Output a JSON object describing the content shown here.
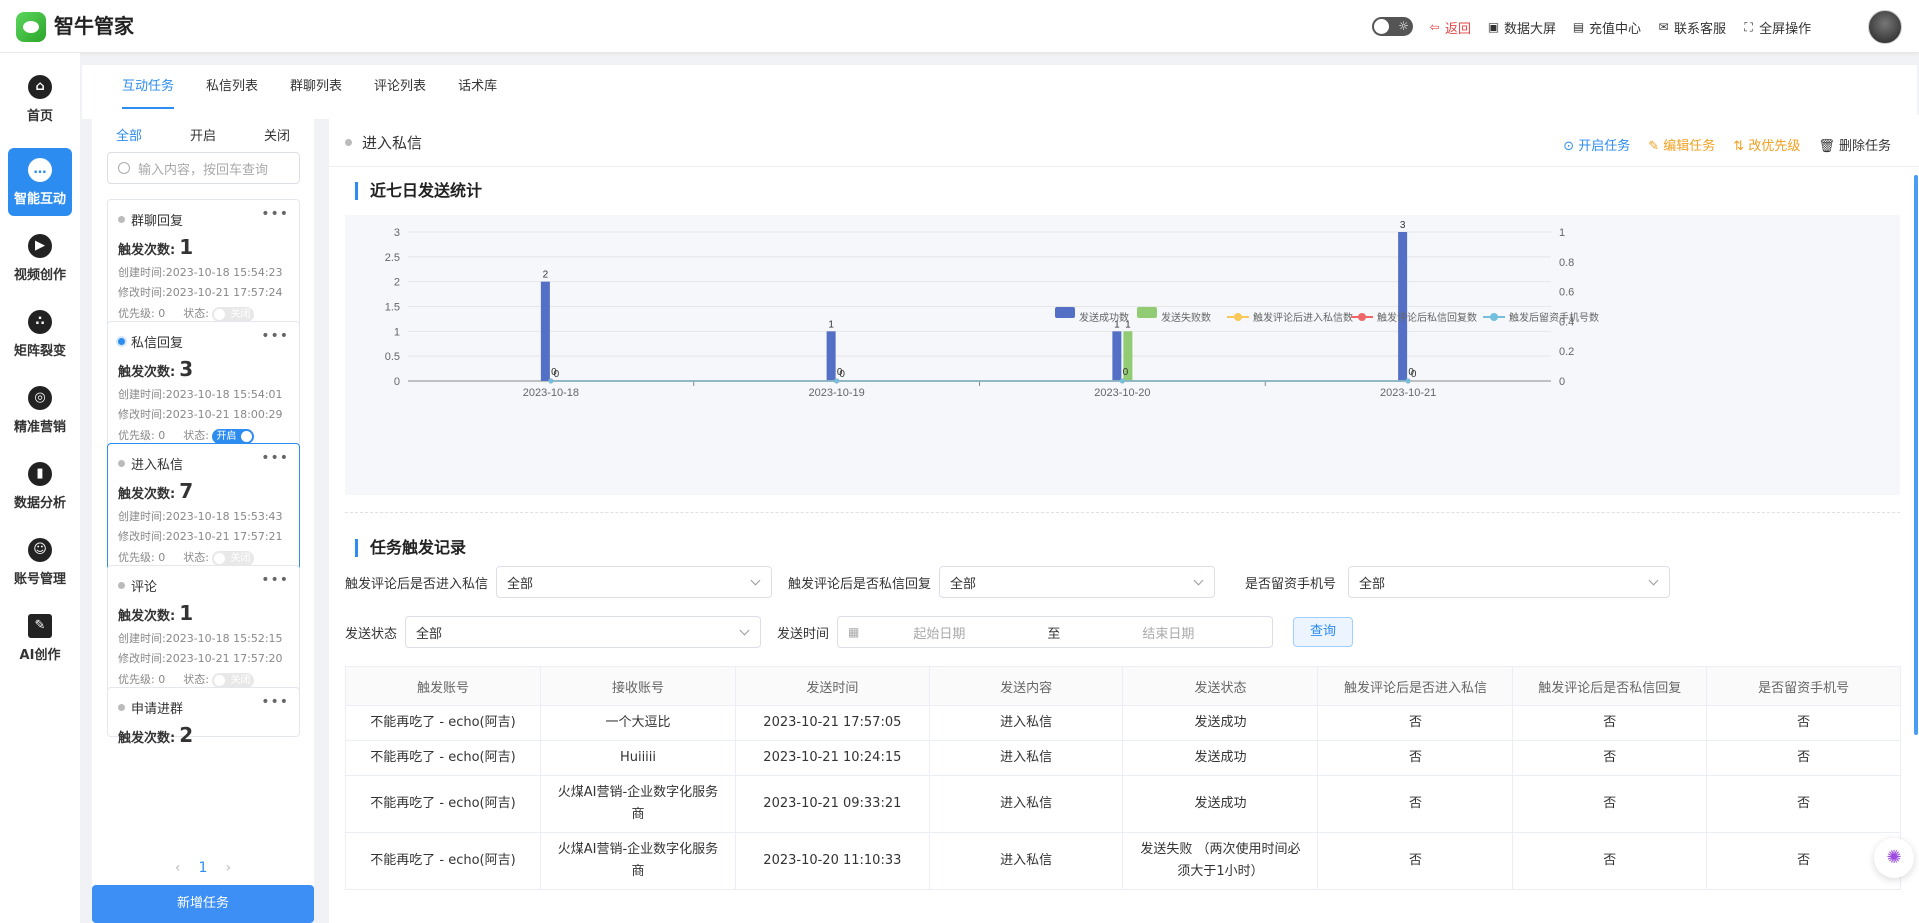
{
  "app": {
    "name": "智牛管家"
  },
  "topbar": {
    "actions": [
      {
        "label": "返回",
        "icon": "back-icon"
      },
      {
        "label": "数据大屏",
        "icon": "dashboard-icon"
      },
      {
        "label": "充值中心",
        "icon": "recharge-icon"
      },
      {
        "label": "联系客服",
        "icon": "chat-icon"
      },
      {
        "label": "全屏操作",
        "icon": "fullscreen-icon"
      }
    ]
  },
  "leftnav": [
    {
      "label": "首页",
      "icon": "home-icon"
    },
    {
      "label": "智能互动",
      "icon": "chat-bubble-icon",
      "active": true
    },
    {
      "label": "视频创作",
      "icon": "video-icon"
    },
    {
      "label": "矩阵裂变",
      "icon": "share-icon"
    },
    {
      "label": "精准营销",
      "icon": "target-icon"
    },
    {
      "label": "数据分析",
      "icon": "chart-icon"
    },
    {
      "label": "账号管理",
      "icon": "account-icon"
    },
    {
      "label": "AI创作",
      "icon": "ai-write-icon"
    }
  ],
  "tabs": [
    "互动任务",
    "私信列表",
    "群聊列表",
    "评论列表",
    "话术库"
  ],
  "tasklist": {
    "filters": [
      "全部",
      "开启",
      "关闭"
    ],
    "search_placeholder": "输入内容，按回车查询",
    "count_label": "触发次数:",
    "created_label": "创建时间:",
    "modified_label": "修改时间:",
    "priority_label": "优先级:",
    "status_label": "状态:",
    "cards": [
      {
        "title": "群聊回复",
        "count": "1",
        "created": "2023-10-18 15:54:23",
        "modified": "2023-10-21 17:57:24",
        "priority": "0",
        "switch": "关闭",
        "on": false
      },
      {
        "title": "私信回复",
        "count": "3",
        "created": "2023-10-18 15:54:01",
        "modified": "2023-10-21 18:00:29",
        "priority": "0",
        "switch": "开启",
        "on": true
      },
      {
        "title": "进入私信",
        "count": "7",
        "created": "2023-10-18 15:53:43",
        "modified": "2023-10-21 17:57:21",
        "priority": "0",
        "switch": "关闭",
        "on": false
      },
      {
        "title": "评论",
        "count": "1",
        "created": "2023-10-18 15:52:15",
        "modified": "2023-10-21 17:57:20",
        "priority": "0",
        "switch": "关闭",
        "on": false
      },
      {
        "title": "申请进群",
        "count": "2"
      }
    ],
    "page": "1",
    "new_task": "新增任务"
  },
  "main": {
    "title": "进入私信",
    "actions": [
      "开启任务",
      "编辑任务",
      "改优先级",
      "删除任务"
    ],
    "stats_title": "近七日发送统计",
    "records_title": "任务触发记录",
    "filters": {
      "f1_label": "触发评论后是否进入私信",
      "f1_value": "全部",
      "f2_label": "触发评论后是否私信回复",
      "f2_value": "全部",
      "f3_label": "是否留资手机号",
      "f3_value": "全部",
      "f4_label": "发送状态",
      "f4_value": "全部",
      "f5_label": "发送时间",
      "start_placeholder": "起始日期",
      "to": "至",
      "end_placeholder": "结束日期",
      "query": "查询"
    },
    "table": {
      "headers": [
        "触发账号",
        "接收账号",
        "发送时间",
        "发送内容",
        "发送状态",
        "触发评论后是否进入私信",
        "触发评论后是否私信回复",
        "是否留资手机号"
      ],
      "rows": [
        [
          "不能再吃了 - echo(阿吉)",
          "一个大逗比",
          "2023-10-21 17:57:05",
          "进入私信",
          "发送成功",
          "否",
          "否",
          "否"
        ],
        [
          "不能再吃了 - echo(阿吉)",
          "Huiiiii",
          "2023-10-21 10:24:15",
          "进入私信",
          "发送成功",
          "否",
          "否",
          "否"
        ],
        [
          "不能再吃了 - echo(阿吉)",
          "火煤AI营销-企业数字化服务商",
          "2023-10-21 09:33:21",
          "进入私信",
          "发送成功",
          "否",
          "否",
          "否"
        ],
        [
          "不能再吃了 - echo(阿吉)",
          "火煤AI营销-企业数字化服务商",
          "2023-10-20 11:10:33",
          "进入私信",
          "发送失败 （两次使用时间必须大于1小时）",
          "否",
          "否",
          "否"
        ]
      ]
    }
  },
  "chart_data": {
    "type": "bar",
    "categories": [
      "2023-10-18",
      "2023-10-19",
      "2023-10-20",
      "2023-10-21"
    ],
    "series": [
      {
        "name": "发送成功数",
        "type": "bar",
        "axis": "left",
        "color": "#5470c6",
        "values": [
          2,
          1,
          1,
          3
        ]
      },
      {
        "name": "发送失败数",
        "type": "bar",
        "axis": "left",
        "color": "#91cc75",
        "values": [
          0,
          0,
          1,
          0
        ]
      },
      {
        "name": "触发评论后进入私信数",
        "type": "line",
        "axis": "right",
        "color": "#fac858",
        "values": [
          0,
          0,
          0,
          0
        ]
      },
      {
        "name": "触发评论后私信回复数",
        "type": "line",
        "axis": "right",
        "color": "#ee6666",
        "values": [
          0,
          0,
          0,
          0
        ]
      },
      {
        "name": "触发后留资手机号数",
        "type": "line",
        "axis": "right",
        "color": "#73c0de",
        "values": [
          0,
          0,
          0,
          0
        ]
      }
    ],
    "ylim_left": [
      0,
      3
    ],
    "yticks_left": [
      "0",
      "0.5",
      "1",
      "1.5",
      "2",
      "2.5",
      "3"
    ],
    "ylim_right": [
      0,
      1
    ],
    "yticks_right": [
      "0",
      "0.2",
      "0.4",
      "0.6",
      "0.8",
      "1"
    ],
    "legend": "top-right",
    "grid": true
  }
}
